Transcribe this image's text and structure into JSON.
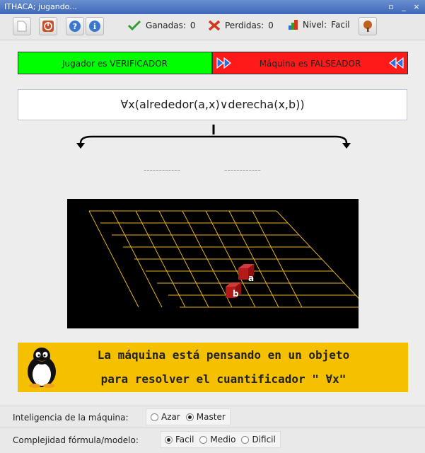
{
  "window": {
    "title": "ITHACA; jugando...",
    "controls": [
      "▫",
      "_",
      "×"
    ]
  },
  "toolbar": {
    "buttons": [
      {
        "name": "new-game",
        "icon": "document-icon"
      },
      {
        "name": "quit",
        "icon": "power-icon"
      },
      {
        "name": "help",
        "icon": "help-icon"
      },
      {
        "name": "info",
        "icon": "info-icon"
      },
      {
        "name": "tree",
        "icon": "tree-icon"
      }
    ],
    "ganadas_label": "Ganadas:",
    "ganadas_value": "0",
    "perdidas_label": "Perdidas:",
    "perdidas_value": "0",
    "nivel_label": "Nivel:",
    "nivel_value": "Facil"
  },
  "players": {
    "left": "Jugador es VERIFICADOR",
    "right": "Máquina es FALSEADOR",
    "left_color": "#00ff00",
    "right_color": "#ff1a1a"
  },
  "formula": "∀x(alrededor(a,x)∨derecha(x,b))",
  "branches": {
    "left": "------------",
    "right": "------------"
  },
  "board": {
    "objects": [
      {
        "label": "a"
      },
      {
        "label": "b"
      }
    ]
  },
  "message": {
    "line1": "La máquina está pensando en un objeto",
    "line2": "para resolver el cuantificador \" ∀x\""
  },
  "options": {
    "ai_label": "Inteligencia de la máquina:",
    "ai_options": [
      "Azar",
      "Master"
    ],
    "ai_selected": "Master",
    "complexity_label": "Complejidad fórmula/modelo:",
    "complexity_options": [
      "Facil",
      "Medio",
      "Dificil"
    ],
    "complexity_selected": "Facil"
  }
}
